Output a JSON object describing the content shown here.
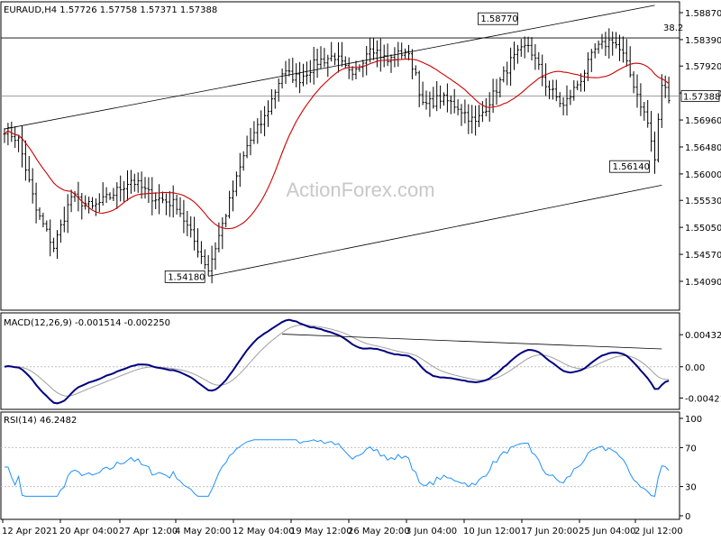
{
  "chart_data": {
    "type": "candlestick",
    "main": {
      "header": "EURAUD,H4  1.57726 1.57758 1.57371 1.57388",
      "price_ticks": [
        "1.58870",
        "1.58390",
        "1.57920",
        "1.57440",
        "1.56960",
        "1.56480",
        "1.56000",
        "1.55530",
        "1.55050",
        "1.54570",
        "1.54090"
      ],
      "last_price": "1.57388",
      "fib_label": "38.2",
      "fib_level": 1.5842,
      "annotations": [
        {
          "text": "1.58770",
          "price": 1.5877,
          "bar": 146
        },
        {
          "text": "1.56140",
          "price": 1.5614,
          "bar": 184
        },
        {
          "text": "1.54180",
          "price": 1.5418,
          "bar": 58
        }
      ],
      "channel_upper": [
        {
          "bar": 0,
          "price": 1.568
        },
        {
          "bar": 185,
          "price": 1.59
        }
      ],
      "channel_lower": [
        {
          "bar": 58,
          "price": 1.5418
        },
        {
          "bar": 187,
          "price": 1.558
        }
      ],
      "ma_color": "#cc0000",
      "watermark": "ActionForex.com"
    },
    "macd": {
      "header": "MACD(12,26,9) -0.001514 -0.002250",
      "ticks": [
        "0.004325",
        "0.00",
        "-0.004213"
      ],
      "ylim": [
        -0.0055,
        0.0052
      ],
      "trendline": [
        {
          "bar": 79,
          "value": 0.0044
        },
        {
          "bar": 187,
          "value": 0.0024
        }
      ],
      "main_color": "#000080",
      "signal_color": "#a0a0a0"
    },
    "rsi": {
      "header": "RSI(14) 46.2482",
      "ticks": [
        "100",
        "70",
        "30",
        "0"
      ],
      "ylim": [
        0,
        100
      ],
      "line_color": "#1e90ff"
    },
    "x_labels": [
      "12 Apr 2021",
      "20 Apr 04:00",
      "27 Apr 12:00",
      "4 May 20:00",
      "12 May 04:00",
      "19 May 12:00",
      "26 May 20:00",
      "3 Jun 04:00",
      "10 Jun 12:00",
      "17 Jun 20:00",
      "25 Jun 04:00",
      "2 Jul 12:00"
    ],
    "close_points": [
      [
        0,
        1.568
      ],
      [
        4,
        1.566
      ],
      [
        9,
        1.5535
      ],
      [
        14,
        1.547
      ],
      [
        19,
        1.556
      ],
      [
        25,
        1.554
      ],
      [
        30,
        1.556
      ],
      [
        36,
        1.559
      ],
      [
        42,
        1.556
      ],
      [
        49,
        1.5545
      ],
      [
        54,
        1.548
      ],
      [
        58,
        1.543
      ],
      [
        63,
        1.553
      ],
      [
        69,
        1.565
      ],
      [
        74,
        1.57
      ],
      [
        79,
        1.578
      ],
      [
        84,
        1.577
      ],
      [
        89,
        1.58
      ],
      [
        94,
        1.581
      ],
      [
        99,
        1.577
      ],
      [
        104,
        1.583
      ],
      [
        109,
        1.58
      ],
      [
        114,
        1.582
      ],
      [
        117,
        1.578
      ],
      [
        119,
        1.572
      ],
      [
        124,
        1.5735
      ],
      [
        129,
        1.572
      ],
      [
        134,
        1.569
      ],
      [
        139,
        1.574
      ],
      [
        144,
        1.58
      ],
      [
        149,
        1.583
      ],
      [
        154,
        1.576
      ],
      [
        159,
        1.572
      ],
      [
        164,
        1.577
      ],
      [
        168,
        1.582
      ],
      [
        173,
        1.584
      ],
      [
        176,
        1.581
      ],
      [
        179,
        1.576
      ],
      [
        183,
        1.569
      ],
      [
        185,
        1.5625
      ],
      [
        187,
        1.576
      ],
      [
        189,
        1.5739
      ]
    ]
  }
}
